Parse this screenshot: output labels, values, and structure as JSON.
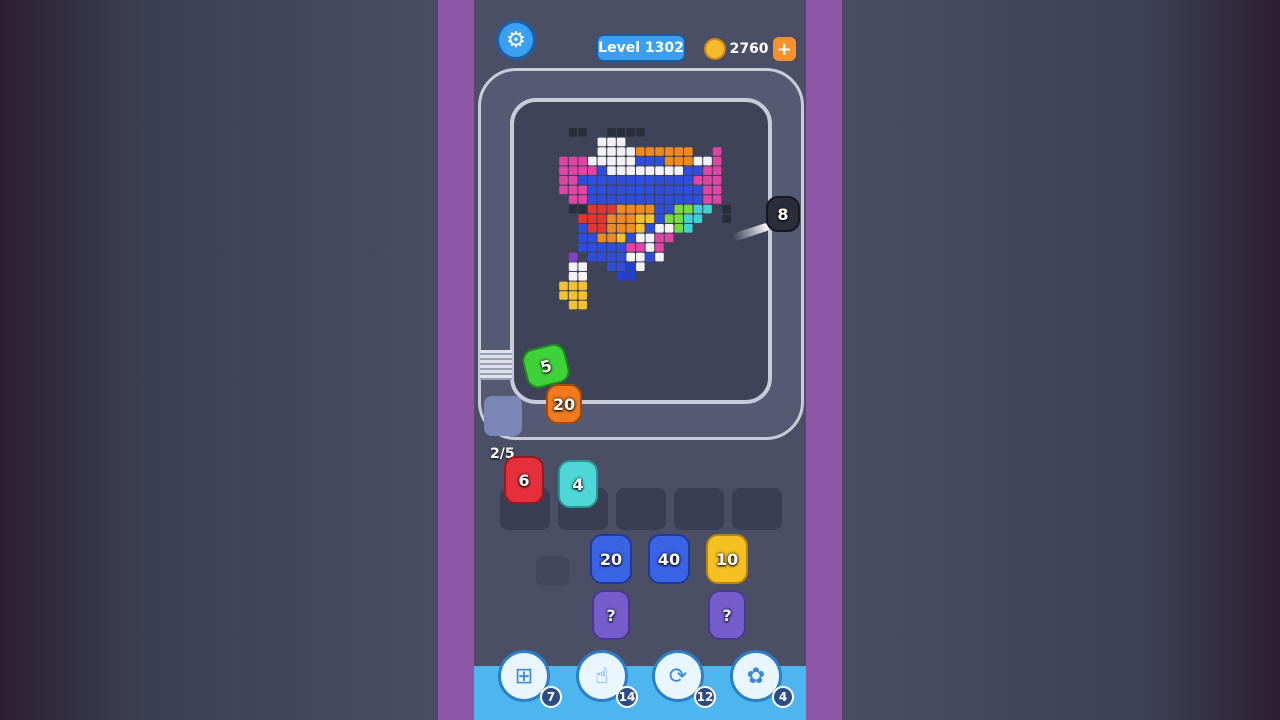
{
  "hud": {
    "level_label": "Level 1302",
    "coins": "2760",
    "coin_plus": "+"
  },
  "icons": {
    "settings": "gear-icon",
    "coin": "coin-icon",
    "add_slot": "add-slot-icon",
    "tap": "hand-pointer-icon",
    "shuffle": "shuffle-icon",
    "bunny": "bunny-helper-icon"
  },
  "belt": {
    "shooter_on_belt": {
      "count": "8",
      "color": "#2b2e3a"
    },
    "queue_indicator": "2/5",
    "waiting": [
      {
        "count": "5",
        "color": "#3fd13a"
      },
      {
        "count": "20",
        "color": "#f07a1e"
      }
    ]
  },
  "holding_slots": [
    {
      "count": "6",
      "color": "#e5303b"
    },
    {
      "count": "4",
      "color": "#4fd6d6"
    },
    {
      "count": "",
      "color": ""
    },
    {
      "count": "",
      "color": ""
    },
    {
      "count": "",
      "color": ""
    }
  ],
  "reserve_columns": [
    {
      "top": {
        "count": "20",
        "color": "#3a63e6"
      },
      "below": {
        "count": "?",
        "color": "#7a5fd6"
      }
    },
    {
      "top": {
        "count": "40",
        "color": "#3a63e6"
      },
      "below": null
    },
    {
      "top": {
        "count": "10",
        "color": "#f5c021"
      },
      "below": {
        "count": "?",
        "color": "#7a5fd6"
      }
    }
  ],
  "powerups": [
    {
      "icon": "add-slot-icon",
      "count": "7"
    },
    {
      "icon": "hand-pointer-icon",
      "count": "14"
    },
    {
      "icon": "shuffle-icon",
      "count": "12"
    },
    {
      "icon": "bunny-helper-icon",
      "count": "4"
    }
  ],
  "colors": {
    "frame_purple": "#8e56a6",
    "board_bg": "#4b4f66",
    "belt": "#c8ccd8",
    "bottom_bar": "#4db6ef"
  }
}
